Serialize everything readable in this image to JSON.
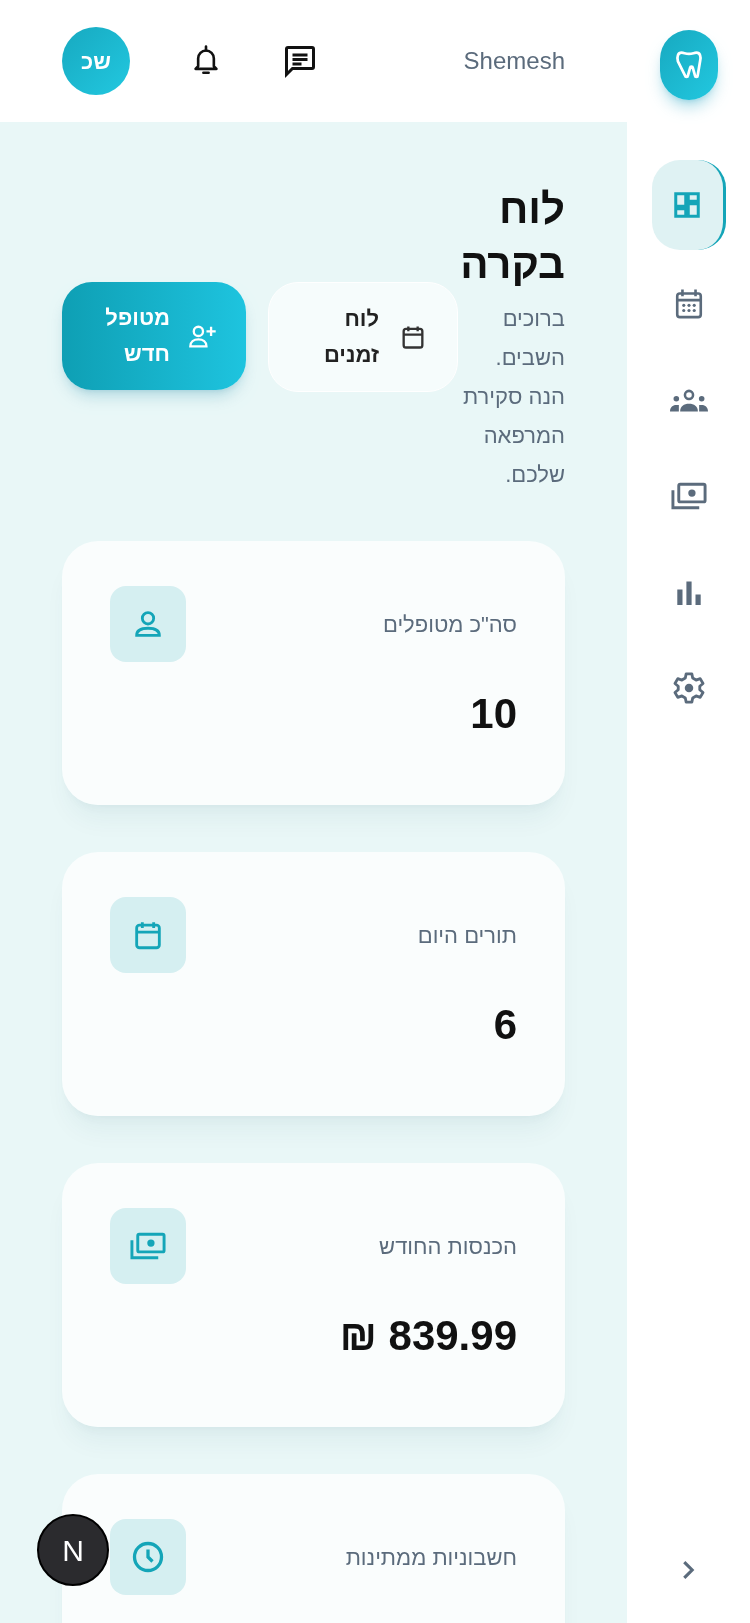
{
  "header": {
    "user_name": "Shemesh",
    "avatar_initials": "שכ"
  },
  "page": {
    "title": "לוח בקרה",
    "subtitle": "ברוכים השבים. הנה סקירת המרפאה שלכם."
  },
  "buttons": [
    {
      "label": "לוח זמנים",
      "kind": "secondary"
    },
    {
      "label": "מטופל חדש",
      "kind": "primary"
    }
  ],
  "stats": [
    {
      "label": "סה\"כ מטופלים",
      "value": "10",
      "kind": "person"
    },
    {
      "label": "תורים היום",
      "value": "6",
      "kind": "calendar"
    },
    {
      "label": "הכנסות החודש",
      "value": "839.99 ₪",
      "kind": "money"
    },
    {
      "label": "חשבוניות ממתינות",
      "kind": "clock"
    }
  ],
  "sidebar": {
    "items": [
      {
        "kind": "dashboard",
        "selected": true
      },
      {
        "kind": "calendar",
        "selected": false
      },
      {
        "kind": "people",
        "selected": false
      },
      {
        "kind": "money",
        "selected": false
      },
      {
        "kind": "chart",
        "selected": false
      },
      {
        "kind": "settings",
        "selected": false
      }
    ]
  },
  "dev_badge": "N"
}
